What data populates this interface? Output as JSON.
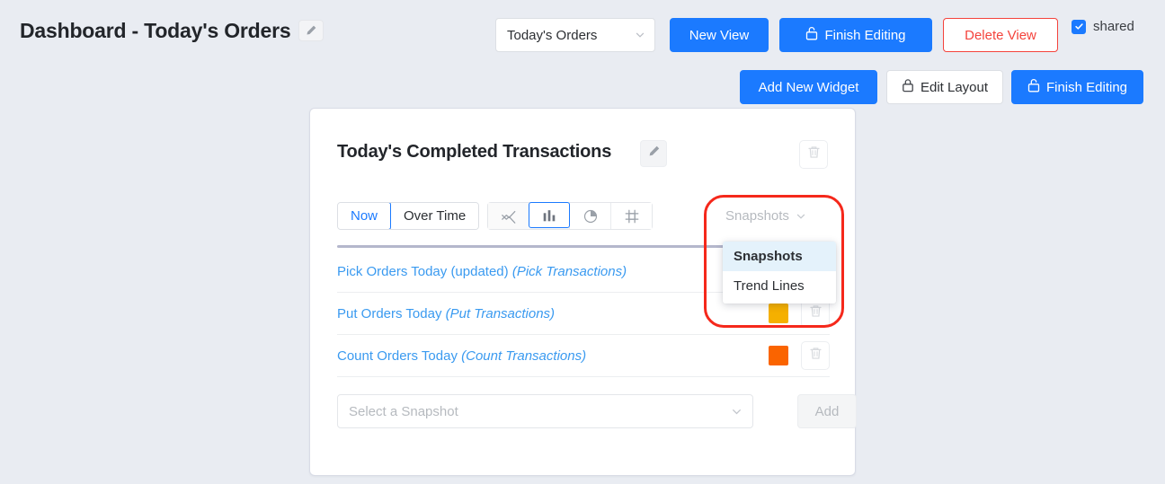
{
  "header": {
    "page_title": "Dashboard - Today's Orders",
    "edit_title_icon": "pencil-icon",
    "view_select": {
      "value": "Today's Orders",
      "caret_icon": "chevron-down-icon"
    },
    "new_view_label": "New View",
    "finish_editing_label": "Finish Editing",
    "finish_editing_icon": "unlock-icon",
    "delete_view_label": "Delete View",
    "shared_label": "shared",
    "shared_checked": true,
    "check_icon": "check-icon"
  },
  "layout_toolbar": {
    "add_widget_label": "Add New Widget",
    "edit_layout_label": "Edit Layout",
    "edit_layout_icon": "lock-icon",
    "finish_editing_label": "Finish Editing",
    "finish_editing_icon": "unlock-icon"
  },
  "widget": {
    "title": "Today's Completed Transactions",
    "title_edit_icon": "pencil-icon",
    "delete_icon": "trash-icon",
    "time_toggle": {
      "options": [
        "Now",
        "Over Time"
      ],
      "selected": "Now"
    },
    "chart_types": [
      {
        "name": "line-chart-icon",
        "selected": false
      },
      {
        "name": "bar-chart-icon",
        "selected": true
      },
      {
        "name": "pie-chart-icon",
        "selected": false
      },
      {
        "name": "settings-grid-icon",
        "selected": false
      }
    ],
    "source_dropdown": {
      "value": "Snapshots",
      "caret_icon": "chevron-down-icon",
      "open": true,
      "options": [
        "Snapshots",
        "Trend Lines"
      ],
      "selected": "Snapshots",
      "highlight_color": "#f5281b"
    },
    "series": [
      {
        "name": "Pick Orders Today (updated)",
        "source": "(Pick Transactions)",
        "color": "",
        "delete_icon": "trash-icon"
      },
      {
        "name": "Put Orders Today",
        "source": "(Put Transactions)",
        "color": "#f5b000",
        "delete_icon": "trash-icon"
      },
      {
        "name": "Count Orders Today",
        "source": "(Count Transactions)",
        "color": "#fa6400",
        "delete_icon": "trash-icon"
      }
    ],
    "add_series": {
      "placeholder": "Select a Snapshot",
      "caret_icon": "chevron-down-icon",
      "add_label": "Add"
    }
  },
  "colors": {
    "page_background": "#e9ecf2",
    "accent": "#1b7aff",
    "link": "#3a9af0",
    "danger": "#f4433c"
  }
}
